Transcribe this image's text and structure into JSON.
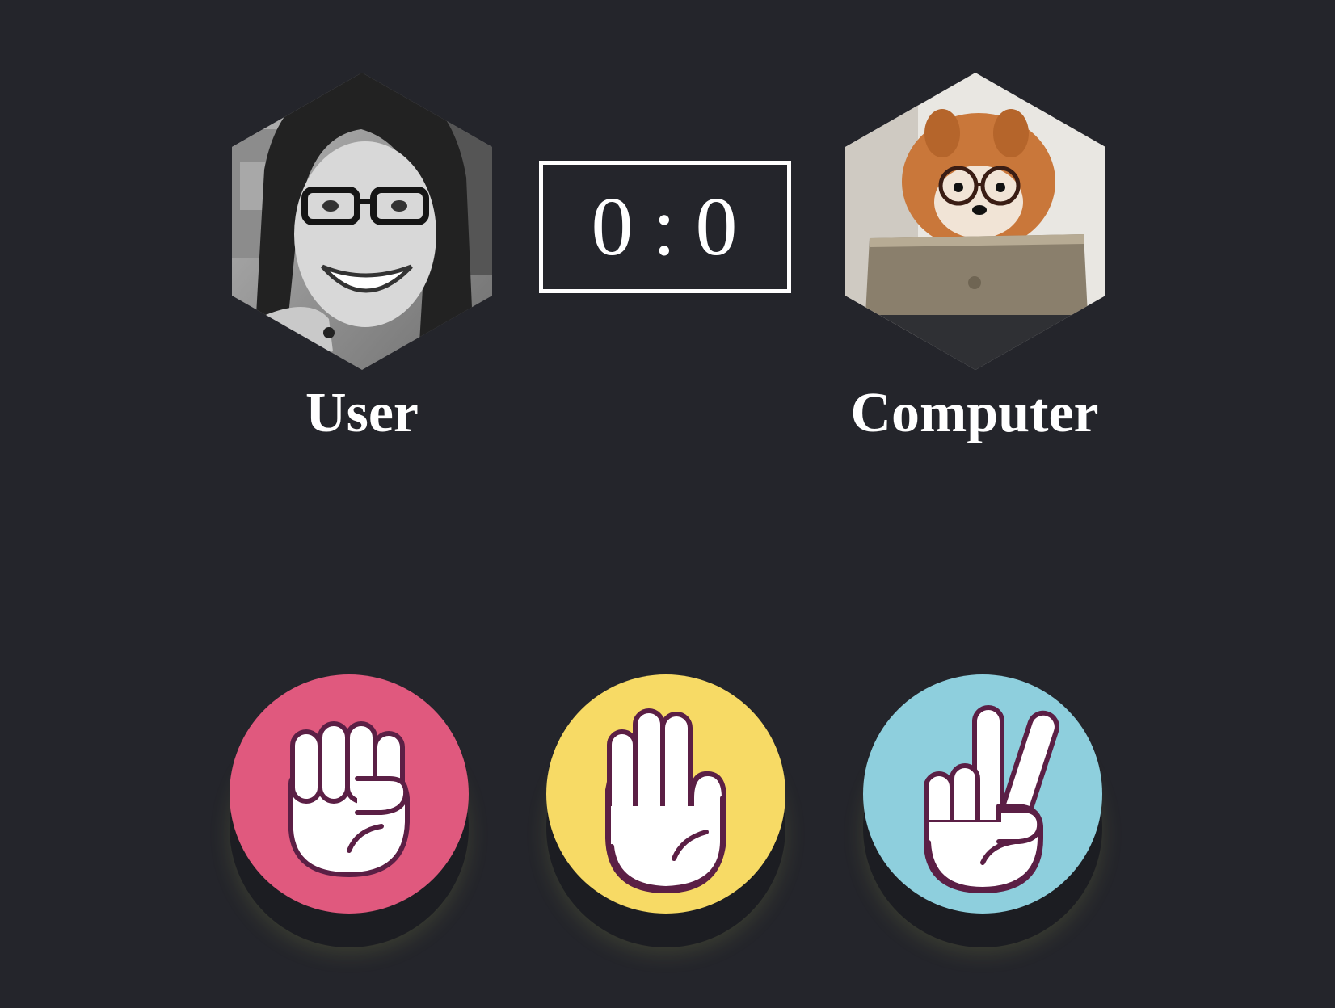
{
  "players": {
    "user": {
      "name": "User",
      "avatar_icon": "woman-with-glasses-avatar"
    },
    "computer": {
      "name": "Computer",
      "avatar_icon": "dog-with-glasses-avatar"
    }
  },
  "score": {
    "user": "0",
    "separator": ":",
    "computer": "0"
  },
  "choices": [
    {
      "id": "rock",
      "icon": "fist-icon",
      "color": "#e0597e"
    },
    {
      "id": "paper",
      "icon": "open-hand-icon",
      "color": "#f7da65"
    },
    {
      "id": "scissors",
      "icon": "peace-sign-icon",
      "color": "#8ecfdd"
    }
  ],
  "colors": {
    "background": "#24252b",
    "text": "#ffffff",
    "hand_outline": "#5b1f45"
  }
}
